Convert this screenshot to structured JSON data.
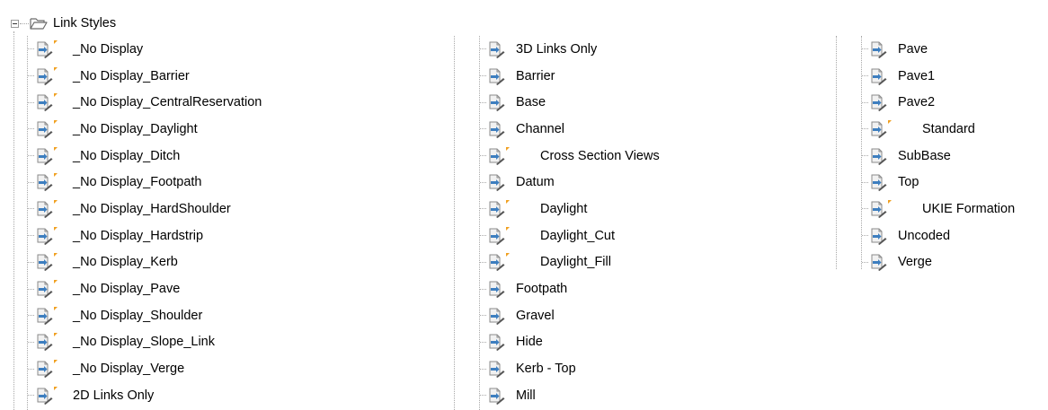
{
  "root": {
    "label": "Link Styles",
    "icon": "folder-open-icon"
  },
  "columns": [
    [
      {
        "label": "_No Display",
        "flagged": true
      },
      {
        "label": "_No Display_Barrier",
        "flagged": true
      },
      {
        "label": "_No Display_CentralReservation",
        "flagged": true
      },
      {
        "label": "_No Display_Daylight",
        "flagged": true
      },
      {
        "label": "_No Display_Ditch",
        "flagged": true
      },
      {
        "label": "_No Display_Footpath",
        "flagged": true
      },
      {
        "label": "_No Display_HardShoulder",
        "flagged": true
      },
      {
        "label": "_No Display_Hardstrip",
        "flagged": true
      },
      {
        "label": "_No Display_Kerb",
        "flagged": true
      },
      {
        "label": "_No Display_Pave",
        "flagged": true
      },
      {
        "label": "_No Display_Shoulder",
        "flagged": true
      },
      {
        "label": "_No Display_Slope_Link",
        "flagged": true
      },
      {
        "label": "_No Display_Verge",
        "flagged": true
      },
      {
        "label": "2D Links Only",
        "flagged": true
      }
    ],
    [
      {
        "label": "3D Links Only",
        "flagged": false
      },
      {
        "label": "Barrier",
        "flagged": false
      },
      {
        "label": "Base",
        "flagged": false
      },
      {
        "label": "Channel",
        "flagged": false
      },
      {
        "label": "Cross Section Views",
        "flagged": true
      },
      {
        "label": "Datum",
        "flagged": false
      },
      {
        "label": "Daylight",
        "flagged": true
      },
      {
        "label": "Daylight_Cut",
        "flagged": true
      },
      {
        "label": "Daylight_Fill",
        "flagged": true
      },
      {
        "label": "Footpath",
        "flagged": false
      },
      {
        "label": "Gravel",
        "flagged": false
      },
      {
        "label": "Hide",
        "flagged": false
      },
      {
        "label": "Kerb - Top",
        "flagged": false
      },
      {
        "label": "Mill",
        "flagged": false
      }
    ],
    [
      {
        "label": "Pave",
        "flagged": false
      },
      {
        "label": "Pave1",
        "flagged": false
      },
      {
        "label": "Pave2",
        "flagged": false
      },
      {
        "label": "Standard",
        "flagged": true
      },
      {
        "label": "SubBase",
        "flagged": false
      },
      {
        "label": "Top",
        "flagged": false
      },
      {
        "label": "UKIE Formation",
        "flagged": true
      },
      {
        "label": "Uncoded",
        "flagged": false
      },
      {
        "label": "Verge",
        "flagged": false
      }
    ]
  ],
  "icons": {
    "item": "link-style-icon",
    "flag": "orange-flag-icon"
  },
  "colors": {
    "doc_fill": "#f1f1f1",
    "doc_border": "#8a8a8a",
    "arrow_blue": "#3d7ebf",
    "pencil_dark": "#555555",
    "flag_orange": "#f0a020",
    "dotted_line": "#a8a8a8"
  }
}
